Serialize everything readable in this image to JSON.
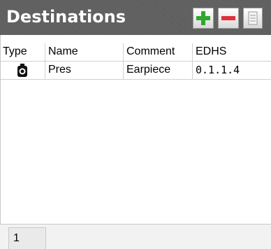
{
  "panel": {
    "title": "Destinations",
    "buttons": {
      "add_icon": "plus-icon",
      "remove_icon": "minus-icon",
      "properties_icon": "list-icon"
    }
  },
  "table": {
    "columns": [
      "Type",
      "Name",
      "Comment",
      "EDHS"
    ],
    "rows": [
      {
        "type_icon": "speaker-icon",
        "name": "Pres",
        "comment": "Earpiece",
        "edhs": "0.1.1.4"
      }
    ]
  },
  "footer": {
    "page": "1"
  },
  "colors": {
    "header_bg": "#5e5e5e",
    "add_green": "#2fa82f",
    "remove_red": "#e0313a"
  }
}
